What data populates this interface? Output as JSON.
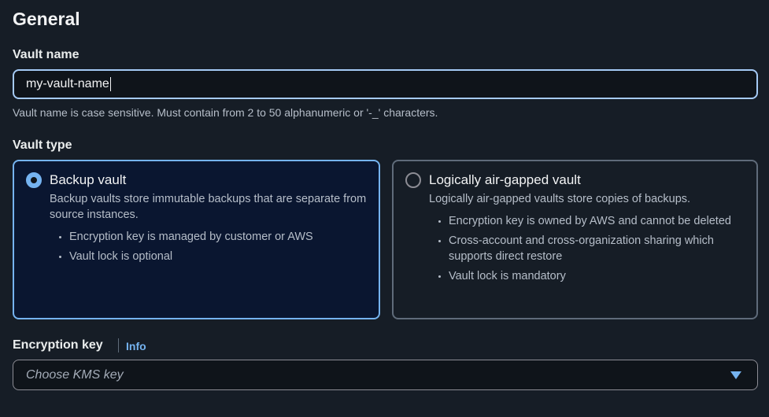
{
  "section": {
    "title": "General"
  },
  "vault_name": {
    "label": "Vault name",
    "value": "my-vault-name",
    "hint": "Vault name is case sensitive. Must contain from 2 to 50 alphanumeric or '-_' characters."
  },
  "vault_type": {
    "label": "Vault type",
    "selected": "backup",
    "options": [
      {
        "title": "Backup vault",
        "description": "Backup vaults store immutable backups that are separate from source instances.",
        "bullets": [
          "Encryption key is managed by customer or AWS",
          "Vault lock is optional"
        ]
      },
      {
        "title": "Logically air-gapped vault",
        "description": "Logically air-gapped vaults store copies of backups.",
        "bullets": [
          "Encryption key is owned by AWS and cannot be deleted",
          "Cross-account and cross-organization sharing which supports direct restore",
          "Vault lock is mandatory"
        ]
      }
    ]
  },
  "encryption_key": {
    "label": "Encryption key",
    "info_link": "Info",
    "placeholder": "Choose KMS key",
    "dropdown_icon": "chevron-down-icon"
  },
  "colors": {
    "background": "#161d26",
    "accent": "#75b3f0",
    "selected_tile_bg": "#0a1630"
  }
}
